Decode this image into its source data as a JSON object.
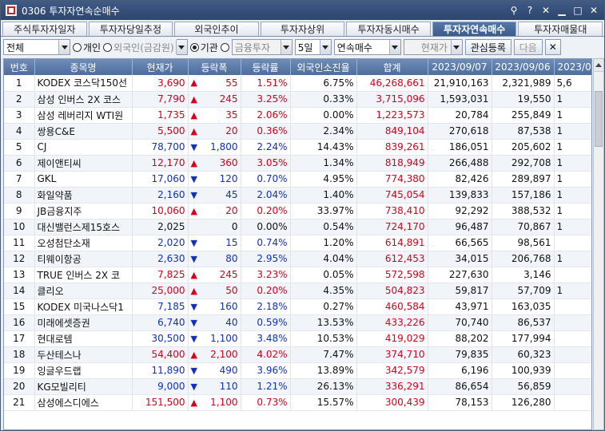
{
  "window": {
    "title": "0306 투자자연속순매수",
    "icons": [
      "pin-icon",
      "help-icon",
      "close-x-icon",
      "minimize-icon",
      "maximize-icon",
      "close-icon"
    ]
  },
  "tabs": [
    {
      "label": "주식투자자일자",
      "active": false
    },
    {
      "label": "투자자당일추정",
      "active": false
    },
    {
      "label": "외국인추이",
      "active": false
    },
    {
      "label": "투자자상위",
      "active": false
    },
    {
      "label": "투자자동시매수",
      "active": false
    },
    {
      "label": "투자자연속매수",
      "active": true
    },
    {
      "label": "투자자매물대",
      "active": false
    }
  ],
  "toolbar": {
    "market": "전체",
    "radio_individual": "개인",
    "radio_foreign": "외국인(금감원)",
    "radio_institution": "기관",
    "institution_type": "금융투자",
    "period": "5일",
    "sort": "연속매수",
    "price_select": "현재가",
    "watch_button": "관심등록",
    "next_button": "다음"
  },
  "table": {
    "headers": [
      "번호",
      "종목명",
      "현재가",
      "등락폭",
      "등락률",
      "외국인소진율",
      "합계",
      "2023/09/07",
      "2023/09/06",
      "2023/09"
    ],
    "rows": [
      {
        "no": "1",
        "name": "KODEX 코스닥150선",
        "price": "3,690",
        "dir": "up",
        "chg": "55",
        "rate": "1.51%",
        "foreign": "6.75%",
        "total": "46,268,661",
        "d1": "21,910,163",
        "d2": "2,321,989",
        "d3": "5,6"
      },
      {
        "no": "2",
        "name": "삼성 인버스 2X 코스",
        "price": "7,790",
        "dir": "up",
        "chg": "245",
        "rate": "3.25%",
        "foreign": "0.33%",
        "total": "3,715,096",
        "d1": "1,593,031",
        "d2": "19,550",
        "d3": "1"
      },
      {
        "no": "3",
        "name": "삼성 레버리지 WTI원",
        "price": "1,735",
        "dir": "up",
        "chg": "35",
        "rate": "2.06%",
        "foreign": "0.00%",
        "total": "1,223,573",
        "d1": "20,784",
        "d2": "255,849",
        "d3": "1"
      },
      {
        "no": "4",
        "name": "쌍용C&E",
        "price": "5,500",
        "dir": "up",
        "chg": "20",
        "rate": "0.36%",
        "foreign": "2.34%",
        "total": "849,104",
        "d1": "270,618",
        "d2": "87,538",
        "d3": "1"
      },
      {
        "no": "5",
        "name": "CJ",
        "price": "78,700",
        "dir": "down",
        "chg": "1,800",
        "rate": "2.24%",
        "foreign": "14.43%",
        "total": "839,261",
        "d1": "186,051",
        "d2": "205,602",
        "d3": "1"
      },
      {
        "no": "6",
        "name": "제이앤티씨",
        "price": "12,170",
        "dir": "up",
        "chg": "360",
        "rate": "3.05%",
        "foreign": "1.34%",
        "total": "818,949",
        "d1": "266,488",
        "d2": "292,708",
        "d3": "1"
      },
      {
        "no": "7",
        "name": "GKL",
        "price": "17,060",
        "dir": "down",
        "chg": "120",
        "rate": "0.70%",
        "foreign": "4.95%",
        "total": "774,380",
        "d1": "82,426",
        "d2": "289,897",
        "d3": "1"
      },
      {
        "no": "8",
        "name": "화일약품",
        "price": "2,160",
        "dir": "down",
        "chg": "45",
        "rate": "2.04%",
        "foreign": "1.40%",
        "total": "745,054",
        "d1": "139,833",
        "d2": "157,186",
        "d3": "1"
      },
      {
        "no": "9",
        "name": "JB금융지주",
        "price": "10,060",
        "dir": "up",
        "chg": "20",
        "rate": "0.20%",
        "foreign": "33.97%",
        "total": "738,410",
        "d1": "92,292",
        "d2": "388,532",
        "d3": "1"
      },
      {
        "no": "10",
        "name": "대신밸런스제15호스",
        "price": "2,025",
        "dir": "none",
        "chg": "0",
        "rate": "0.00%",
        "foreign": "0.54%",
        "total": "724,170",
        "d1": "96,487",
        "d2": "70,867",
        "d3": "1"
      },
      {
        "no": "11",
        "name": "오성첨단소재",
        "price": "2,020",
        "dir": "down",
        "chg": "15",
        "rate": "0.74%",
        "foreign": "1.20%",
        "total": "614,891",
        "d1": "66,565",
        "d2": "98,561",
        "d3": ""
      },
      {
        "no": "12",
        "name": "티웨이항공",
        "price": "2,630",
        "dir": "down",
        "chg": "80",
        "rate": "2.95%",
        "foreign": "4.04%",
        "total": "612,453",
        "d1": "34,015",
        "d2": "206,768",
        "d3": "1"
      },
      {
        "no": "13",
        "name": "TRUE 인버스 2X 코",
        "price": "7,825",
        "dir": "up",
        "chg": "245",
        "rate": "3.23%",
        "foreign": "0.05%",
        "total": "572,598",
        "d1": "227,630",
        "d2": "3,146",
        "d3": ""
      },
      {
        "no": "14",
        "name": "클리오",
        "price": "25,000",
        "dir": "up",
        "chg": "50",
        "rate": "0.20%",
        "foreign": "4.35%",
        "total": "504,823",
        "d1": "59,817",
        "d2": "57,709",
        "d3": "1"
      },
      {
        "no": "15",
        "name": "KODEX 미국나스닥1",
        "price": "7,185",
        "dir": "down",
        "chg": "160",
        "rate": "2.18%",
        "foreign": "0.27%",
        "total": "460,584",
        "d1": "43,971",
        "d2": "163,035",
        "d3": ""
      },
      {
        "no": "16",
        "name": "미래에셋증권",
        "price": "6,740",
        "dir": "down",
        "chg": "40",
        "rate": "0.59%",
        "foreign": "13.53%",
        "total": "433,226",
        "d1": "70,740",
        "d2": "86,537",
        "d3": ""
      },
      {
        "no": "17",
        "name": "현대로템",
        "price": "30,500",
        "dir": "down",
        "chg": "1,100",
        "rate": "3.48%",
        "foreign": "10.53%",
        "total": "419,029",
        "d1": "88,202",
        "d2": "177,994",
        "d3": ""
      },
      {
        "no": "18",
        "name": "두산테스나",
        "price": "54,400",
        "dir": "up",
        "chg": "2,100",
        "rate": "4.02%",
        "foreign": "7.47%",
        "total": "374,710",
        "d1": "79,835",
        "d2": "60,323",
        "d3": ""
      },
      {
        "no": "19",
        "name": "잉글우드랩",
        "price": "11,890",
        "dir": "down",
        "chg": "490",
        "rate": "3.96%",
        "foreign": "13.89%",
        "total": "342,579",
        "d1": "6,196",
        "d2": "100,939",
        "d3": ""
      },
      {
        "no": "20",
        "name": "KG모빌리티",
        "price": "9,000",
        "dir": "down",
        "chg": "110",
        "rate": "1.21%",
        "foreign": "26.13%",
        "total": "336,291",
        "d1": "86,654",
        "d2": "56,859",
        "d3": ""
      },
      {
        "no": "21",
        "name": "삼성에스디에스",
        "price": "151,500",
        "dir": "up",
        "chg": "1,100",
        "rate": "0.73%",
        "foreign": "15.57%",
        "total": "300,439",
        "d1": "78,153",
        "d2": "126,280",
        "d3": ""
      }
    ]
  },
  "colors": {
    "up": "#d6001c",
    "down": "#1030c0",
    "header": "#5577a8"
  }
}
